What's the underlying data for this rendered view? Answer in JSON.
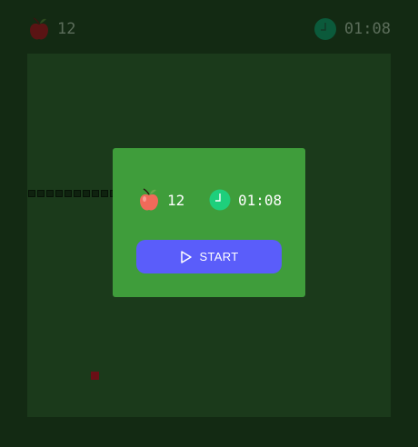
{
  "hud": {
    "score": "12",
    "time": "01:08",
    "apple_icon": "apple-icon",
    "clock_icon": "clock-icon"
  },
  "modal": {
    "score": "12",
    "time": "01:08",
    "start_label": "START",
    "play_icon": "play-icon"
  },
  "colors": {
    "background": "#132a13",
    "board": "#1b3a1b",
    "modal": "#3f9d3b",
    "button": "#5a5dfa",
    "clock": "#1ecf7c",
    "apple": "#f06a5a",
    "food": "#6b0f16"
  }
}
